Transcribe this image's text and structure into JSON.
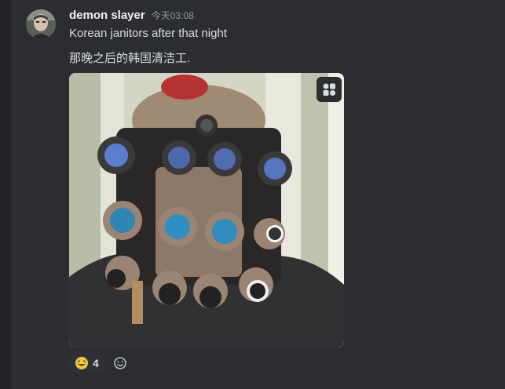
{
  "message": {
    "author": "demon slayer",
    "timestamp": "今天03:08",
    "lines": [
      "Korean janitors after that night",
      "那晚之后的韩国清洁工."
    ]
  },
  "attachment": {
    "alt": "photo-gear-mask",
    "embed_button_icon": "gallery-icon"
  },
  "reactions": [
    {
      "emoji": "laughing-face-icon",
      "count": "4"
    }
  ],
  "add_reaction_icon": "smile-add-icon",
  "colors": {
    "background": "#2b2d31",
    "username": "#f2f3f5",
    "timestamp": "#949ba4",
    "text": "#dbdee1"
  }
}
